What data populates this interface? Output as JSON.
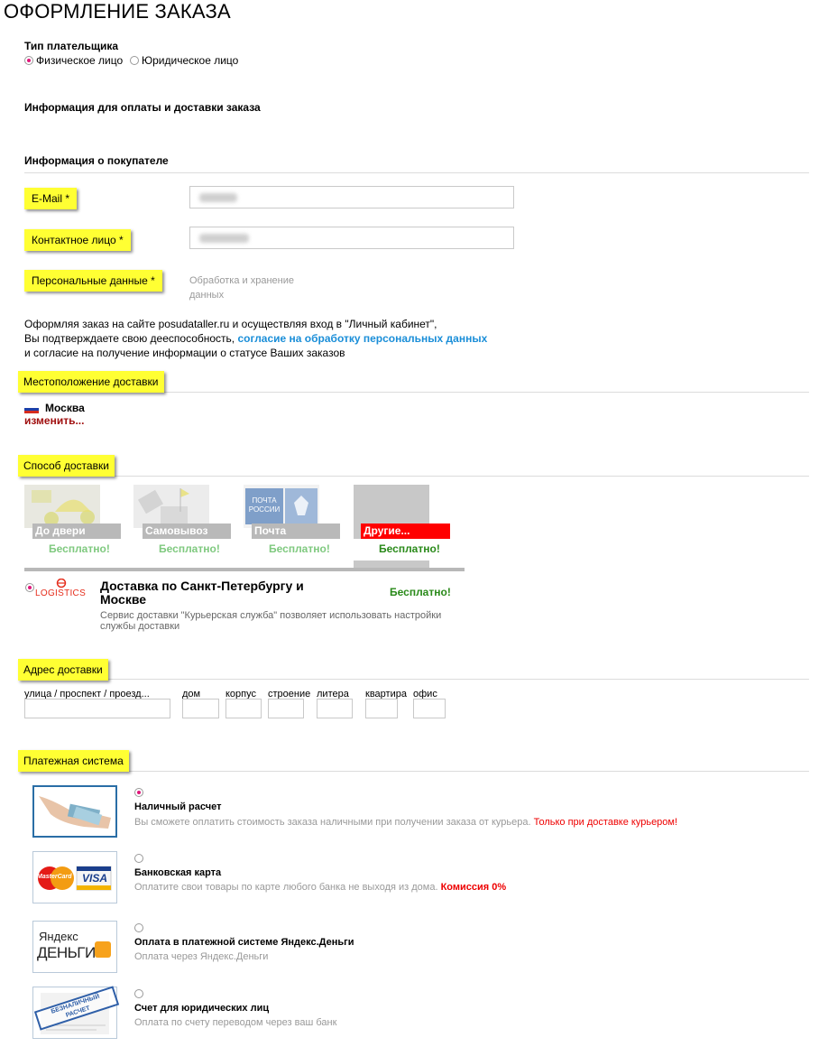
{
  "page_title": "ОФОРМЛЕНИЕ ЗАКАЗА",
  "payer_type": {
    "label": "Тип плательщика",
    "options": [
      "Физическое лицо",
      "Юридическое лицо"
    ],
    "selected": "Физическое лицо"
  },
  "payment_info_heading": "Информация для оплаты и доставки заказа",
  "buyer_info_heading": "Информация о покупателе",
  "fields": {
    "email_label": "E-Mail *",
    "contact_label": "Контактное лицо *",
    "personal_label": "Персональные данные *",
    "personal_note_line1": "Обработка и хранение",
    "personal_note_line2": "данных"
  },
  "consent": {
    "line1": "Оформляя заказ на сайте posudataller.ru и осуществляя вход в \"Личный кабинет\",",
    "line2_prefix": "Вы подтверждаете свою дееспособность, ",
    "line2_link": "согласие на обработку персональных данных",
    "line3": "и согласие на получение информации о статусе Ваших заказов"
  },
  "location": {
    "heading": "Местоположение доставки",
    "city": "Москва",
    "change_link": "изменить..."
  },
  "delivery": {
    "heading": "Способ доставки",
    "tiles": [
      {
        "label": "До двери",
        "price": "Бесплатно!",
        "active": false
      },
      {
        "label": "Самовывоз",
        "price": "Бесплатно!",
        "active": false
      },
      {
        "label": "Почта",
        "price": "Бесплатно!",
        "active": false
      },
      {
        "label": "Другие...",
        "price": "Бесплатно!",
        "active": true
      }
    ],
    "post_logo_line1": "ПОЧТА",
    "post_logo_line2": "РОССИИ",
    "option": {
      "logo_text": "LOGISTICS",
      "title_line1": "Доставка по Санкт-Петербургу и",
      "title_line2": "Москве",
      "price": "Бесплатно!",
      "desc_line1": "Сервис доставки \"Курьерская служба\" позволяет использовать настройки",
      "desc_line2": "службы доставки"
    }
  },
  "address": {
    "heading": "Адрес доставки",
    "fields": [
      "улица / проспект / проезд...",
      "дом",
      "корпус",
      "строение",
      "литера",
      "квартира",
      "офис"
    ]
  },
  "payment": {
    "heading": "Платежная система",
    "options": [
      {
        "title": "Наличный расчет",
        "desc": "Вы сможете оплатить стоимость заказа наличными при получении заказа от курьера.",
        "note": "Только при доставке курьером!",
        "selected": true
      },
      {
        "title": "Банковская карта",
        "desc": "Оплатите свои товары по карте любого банка не выходя из дома.",
        "note": "Комиссия 0%",
        "selected": false
      },
      {
        "title": "Оплата в платежной системе Яндекс.Деньги",
        "desc": "Оплата через Яндекс.Деньги",
        "note": "",
        "selected": false
      },
      {
        "title": "Счет для юридических лиц",
        "desc": "Оплата по счету переводом через ваш банк",
        "note": "",
        "selected": false
      }
    ],
    "card_logos": [
      "MasterCard",
      "VISA"
    ],
    "yandex_logo_line1": "Яндекс",
    "yandex_logo_line2": "ДЕНЬГИ",
    "invoice_stamp_line1": "БЕЗНАЛИЧНЫЙ",
    "invoice_stamp_line2": "РАСЧЕТ"
  }
}
